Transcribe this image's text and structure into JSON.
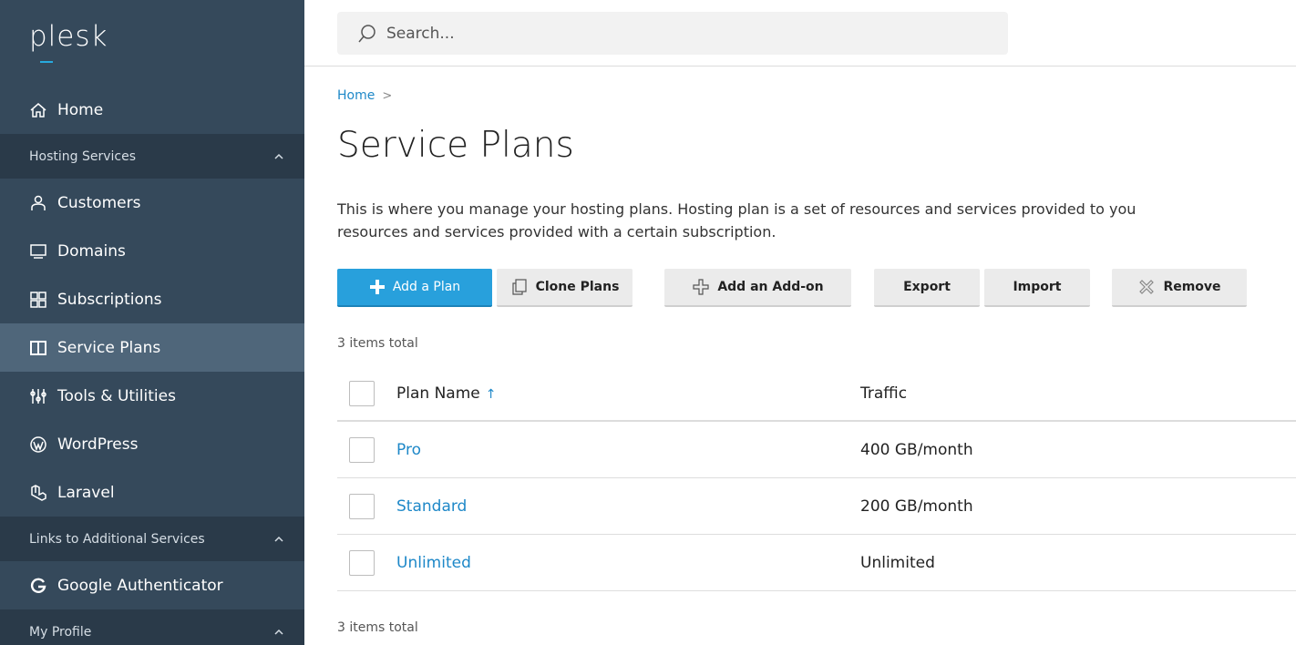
{
  "logo": "plesk",
  "search": {
    "placeholder": "Search..."
  },
  "sidebar": {
    "home": "Home",
    "sections": [
      {
        "label": "Hosting Services"
      },
      {
        "label": "Links to Additional Services"
      },
      {
        "label": "My Profile"
      }
    ],
    "items": [
      {
        "label": "Customers",
        "icon": "user-icon"
      },
      {
        "label": "Domains",
        "icon": "monitor-icon"
      },
      {
        "label": "Subscriptions",
        "icon": "grid-icon"
      },
      {
        "label": "Service Plans",
        "icon": "book-icon",
        "active": true
      },
      {
        "label": "Tools & Utilities",
        "icon": "tools-icon"
      },
      {
        "label": "WordPress",
        "icon": "wordpress-icon"
      },
      {
        "label": "Laravel",
        "icon": "laravel-icon"
      }
    ],
    "google_auth": "Google Authenticator"
  },
  "breadcrumb": {
    "home": "Home",
    "sep": ">"
  },
  "page": {
    "title": "Service Plans",
    "desc_line1": "This is where you manage your hosting plans. Hosting plan is a set of resources and services provided to you",
    "desc_line2": "resources and services provided with a certain subscription."
  },
  "toolbar": {
    "add_plan": "Add a Plan",
    "clone_plans": "Clone Plans",
    "add_addon": "Add an Add-on",
    "export": "Export",
    "import": "Import",
    "remove": "Remove"
  },
  "table": {
    "total_top": "3 items total",
    "total_bottom": "3 items total",
    "col_name": "Plan Name",
    "sort_indicator": "↑",
    "col_traffic": "Traffic",
    "rows": [
      {
        "name": "Pro",
        "traffic": "400 GB/month"
      },
      {
        "name": "Standard",
        "traffic": "200 GB/month"
      },
      {
        "name": "Unlimited",
        "traffic": "Unlimited"
      }
    ]
  },
  "colors": {
    "sidebar_bg": "#35495b",
    "sidebar_section_bg": "#2a3a49",
    "active_item_bg": "#4f667a",
    "accent": "#28a0dc",
    "link": "#1e88c8"
  }
}
